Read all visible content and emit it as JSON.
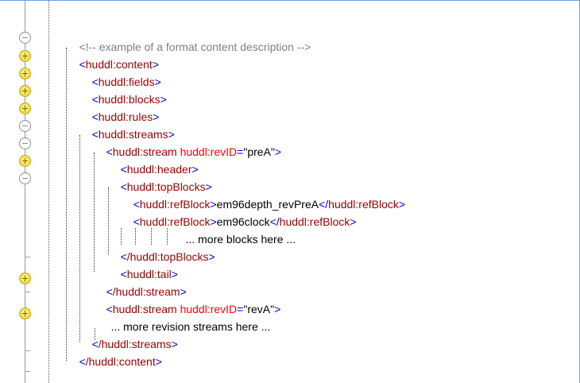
{
  "code": {
    "comment": "<!-- example of a format content description -->",
    "content_open": "huddl:content",
    "fields_open": "huddl:fields",
    "blocks_open": "huddl:blocks",
    "rules_open": "huddl:rules",
    "streams_open": "huddl:streams",
    "stream1_tag": "huddl:stream",
    "stream1_attr": "huddl:revID",
    "stream1_value": "\"preA\"",
    "header_open": "huddl:header",
    "topblocks_open": "huddl:topBlocks",
    "refblock_tag": "huddl:refBlock",
    "refblock1_text": "em96depth_revPreA",
    "refblock2_text": "em96clock",
    "more_blocks_text": "... more blocks here ...",
    "topblocks_close": "/huddl:topBlocks",
    "tail_open": "huddl:tail",
    "stream1_close": "/huddl:stream",
    "stream2_tag": "huddl:stream",
    "stream2_attr": "huddl:revID",
    "stream2_value": "\"revA\"",
    "more_streams_text": "... more revision streams here ...",
    "streams_close": "/huddl:streams",
    "content_close": "/huddl:content"
  },
  "colors": {
    "tag": "#990000",
    "bracket": "#0000cc",
    "attribute": "#ff0000",
    "comment": "#808080",
    "text": "#000000"
  },
  "icons": {
    "collapse": "fold-collapse-icon",
    "expand": "fold-expand-icon"
  }
}
